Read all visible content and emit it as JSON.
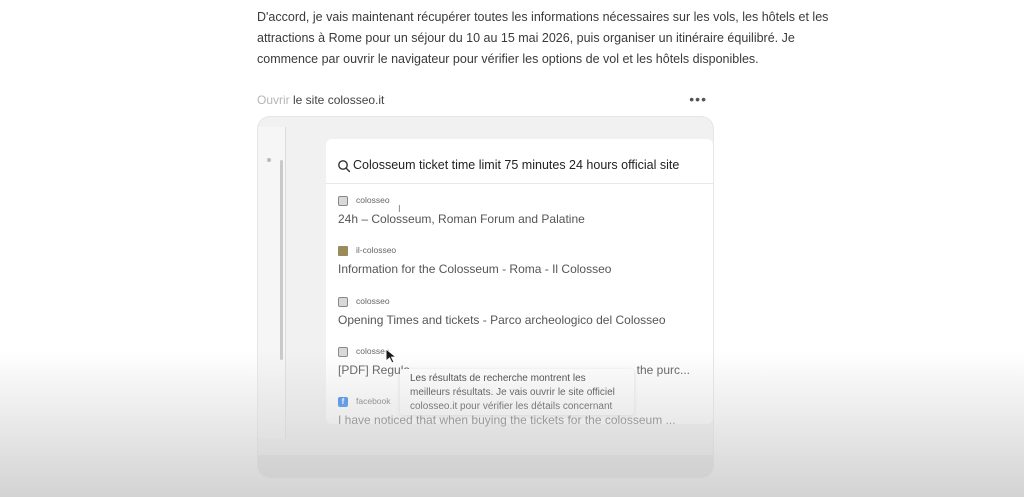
{
  "message": {
    "intro": "D'accord, je vais maintenant récupérer toutes les informations nécessaires sur les vols, les hôtels et les attractions à Rome pour un séjour du 10 au 15 mai 2026, puis organiser un itinéraire équilibré. Je commence par ouvrir le navigateur pour vérifier les options de vol et les hôtels disponibles."
  },
  "step": {
    "verb": "Ouvrir",
    "object": " le site colosseo.it",
    "more_icon": "ellipsis-icon"
  },
  "browser": {
    "search_query": "Colosseum ticket time limit 75 minutes 24 hours official site",
    "results": [
      {
        "source": "colosseo",
        "favicon": "colosseo-icon",
        "title": "24h – Colosseum, Roman Forum and Palatine"
      },
      {
        "source": "il-colosseo",
        "favicon": "il-colosseo-icon",
        "title": "Information for the Colosseum - Roma - Il Colosseo"
      },
      {
        "source": "colosseo",
        "favicon": "colosseo-icon",
        "title": "Opening Times and tickets - Parco archeologico del Colosseo"
      },
      {
        "source": "colosseo",
        "favicon": "colosseo-icon",
        "title": "[PDF] Regula",
        "title_tail": "the purc..."
      },
      {
        "source": "facebook",
        "favicon": "facebook-icon",
        "title": "I have noticed that when buying the tickets for the colosseum ..."
      }
    ]
  },
  "tooltip": {
    "text": "Les résultats de recherche montrent les meilleurs résultats. Je vais ouvrir le site officiel colosseo.it pour vérifier les détails concernant"
  },
  "colors": {
    "facebook": "#1877f2",
    "text_muted": "#b5b5b5"
  }
}
